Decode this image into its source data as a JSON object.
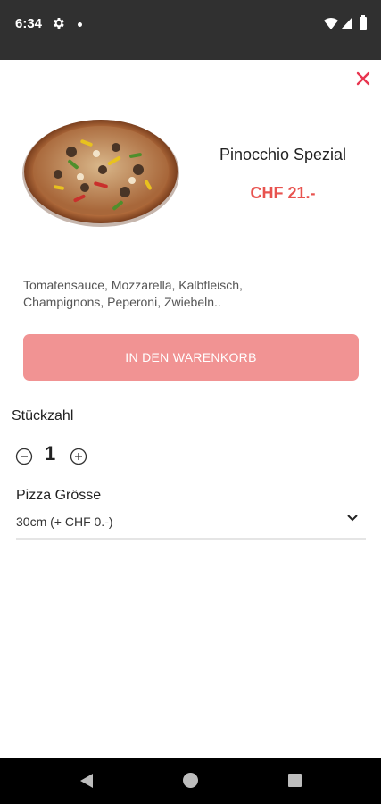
{
  "status_bar": {
    "time": "6:34",
    "icons": [
      "gear-icon",
      "notification-dot",
      "wifi-icon",
      "signal-icon",
      "battery-icon"
    ]
  },
  "product": {
    "title": "Pinocchio Spezial",
    "price": "CHF 21.-",
    "description": "Tomatensauce, Mozzarella, Kalbfleisch, Champignons, Peperoni, Zwiebeln..",
    "image_icon": "pizza-image"
  },
  "actions": {
    "add_to_cart_label": "IN DEN WARENKORB"
  },
  "quantity": {
    "label": "Stückzahl",
    "value": "1",
    "minus_icon": "minus-circle-icon",
    "plus_icon": "plus-circle-icon"
  },
  "size": {
    "label": "Pizza Grösse",
    "selected": "30cm (+ CHF 0.-)"
  },
  "colors": {
    "accent": "#e8534f",
    "button": "#f08a8a",
    "status_bar": "#303030",
    "nav_bar": "#000000"
  }
}
